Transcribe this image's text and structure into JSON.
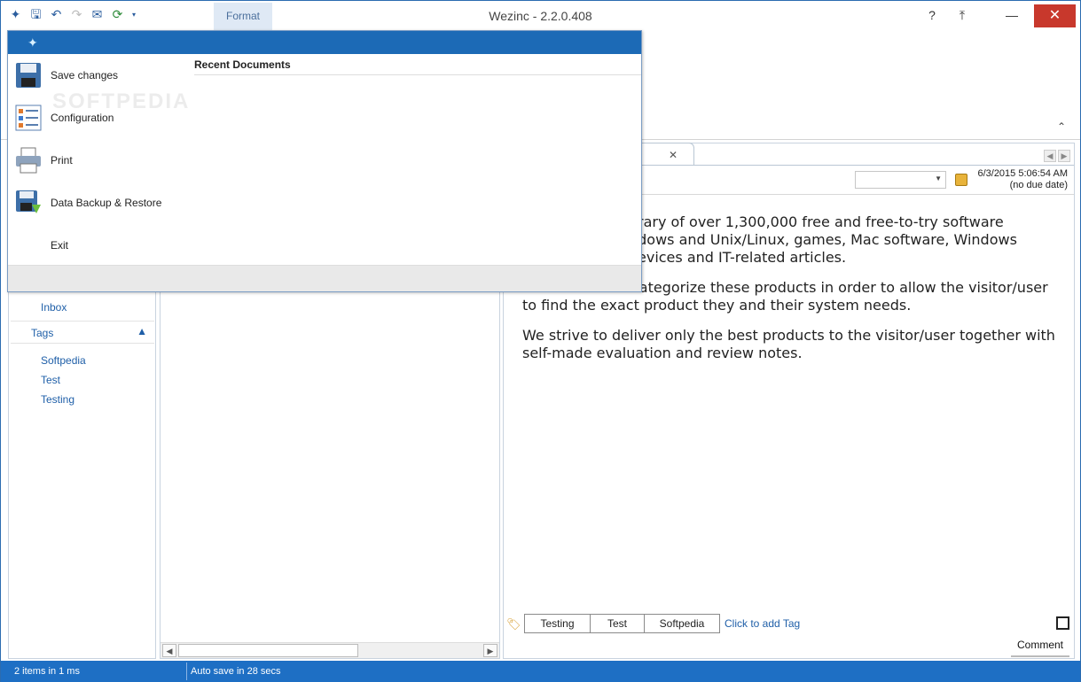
{
  "window": {
    "title": "Wezinc - 2.2.0.408",
    "ribbon_tab": "Format"
  },
  "quick_access": [
    "app-icon",
    "save-icon",
    "undo-icon",
    "redo-icon",
    "send-icon",
    "sync-icon",
    "dropdown-arrow-icon"
  ],
  "app_menu": {
    "items": [
      {
        "label": "Save changes",
        "icon": "floppy-disk-icon"
      },
      {
        "label": "Configuration",
        "icon": "configuration-icon"
      },
      {
        "label": "Print",
        "icon": "printer-icon"
      },
      {
        "label": "Data Backup & Restore",
        "icon": "backup-restore-icon"
      },
      {
        "label": "Exit",
        "icon": ""
      }
    ],
    "recent_documents_title": "Recent Documents",
    "watermark": "SOFTPEDIA"
  },
  "sidebar": {
    "inbox_label": "Inbox",
    "tags_header": "Tags",
    "tags": [
      "Softpedia",
      "Test",
      "Testing"
    ]
  },
  "document": {
    "created": "6/3/2015 5:06:54 AM",
    "due": "(no due date)",
    "paragraphs": [
      "rary of over 1,300,000 free and free-to-try software",
      "ndows and Unix/Linux, games, Mac software, Windows",
      "evices and IT-related articles.",
      "We review and categorize these products in order to allow the visitor/user to find the exact product they and their system needs.",
      "We strive to deliver only the best products to the visitor/user together with self-made evaluation and review notes."
    ],
    "tags": [
      "Testing",
      "Test",
      "Softpedia"
    ],
    "add_tag_label": "Click to add Tag",
    "comment_label": "Comment"
  },
  "status": {
    "items_text": "2 items in 1 ms",
    "autosave_text": "Auto save in 28 secs"
  },
  "colors": {
    "accent": "#1c6ab6",
    "statusbar": "#1e6fc4",
    "close_button": "#c8382c",
    "link": "#1f5fa8"
  }
}
